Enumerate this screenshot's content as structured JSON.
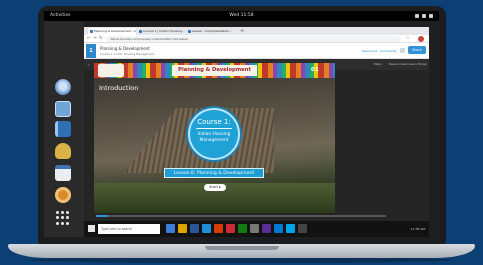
{
  "system": {
    "activities": "Activities",
    "clock": "Wed 11:58"
  },
  "browser": {
    "tabs": [
      {
        "label": "Planning & Development - Ind..."
      },
      {
        "label": "Course 1 | Indian Housing..."
      },
      {
        "label": "Lesson - Implementation..."
      }
    ],
    "new_tab": "+",
    "url": "360.articulate.com/review/content/4db0c7d4-lesson",
    "nav": {
      "back": "←",
      "forward": "→",
      "reload": "↻",
      "star": "☆"
    }
  },
  "course_bar": {
    "badge": "1",
    "title": "Planning & Development",
    "subtitle": "Course 1: Indian Housing Management",
    "link1": "Resources",
    "link2": "Comments",
    "button": "Share"
  },
  "slide_bar": {
    "back": "‹",
    "right_items": [
      "Menu",
      "Resources",
      "Glossary",
      "Notes"
    ]
  },
  "slide": {
    "banner_title": "Planning & Development",
    "number": "01",
    "intro": "Introduction",
    "course_title": "Course 1:",
    "course_subtitle": "Indian Housing Management",
    "lesson": "Lesson 6: Planning & Development",
    "start": "Start ▸"
  },
  "progress": {
    "fraction": 0.04
  },
  "taskbar": {
    "search_placeholder": "Type here to search",
    "icons": [
      "#3b7dd8",
      "#e0a400",
      "#2b5797",
      "#1e8fd6",
      "#d83b01",
      "#cc2a36",
      "#107c10",
      "#777777",
      "#5c2d91",
      "#0078d4",
      "#00a2ed",
      "#444444"
    ],
    "system": "11:58 AM"
  },
  "colors": {
    "accent": "#1fa2d6",
    "page_bg": "#0c3f73"
  }
}
